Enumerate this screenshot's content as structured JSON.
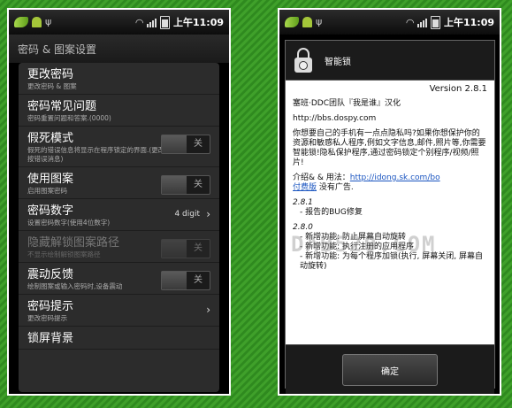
{
  "status_bar": {
    "time": "上午11:09"
  },
  "left_screen": {
    "title": "密码 & 图案设置",
    "items": [
      {
        "title": "更改密码",
        "subtitle": "更改密码 & 图案"
      },
      {
        "title": "密码常见问题",
        "subtitle": "密码重置问题和答案.(0000)"
      },
      {
        "title": "假死模式",
        "subtitle": "假死的错误信息将显示在程序锁定的界面.(更改授权查看时长按错误消息)",
        "toggle": "关"
      },
      {
        "title": "使用图案",
        "subtitle": "启用图案密码",
        "toggle": "关"
      },
      {
        "title": "密码数字",
        "subtitle": "设置密码数字(使用4位数字)",
        "value": "4 digit"
      },
      {
        "title": "隐藏解锁图案路径",
        "subtitle": "不显示绘制解锁图案路径",
        "toggle": "关"
      },
      {
        "title": "震动反馈",
        "subtitle": "绘制图案或输入密码时,设备震动",
        "toggle": "关"
      },
      {
        "title": "密码提示",
        "subtitle": "更改密码提示"
      },
      {
        "title": "锁屏背景",
        "subtitle": ""
      }
    ]
  },
  "right_screen": {
    "dialog_title": "智能锁",
    "version": "Version 2.8.1",
    "credit": "塞班·DDC团队『我是谁』汉化",
    "url": "http://bbs.dospy.com",
    "intro": "你想要自己的手机有一点点隐私吗?如果你想保护你的资源和敏感私人程序,例如文字信息,邮件,照片等,你需要智能锁!隐私保护程序,通过密码锁定个别程序/视频/照片!",
    "intro_link_prefix": "介绍& & 用法：",
    "intro_link": "http://idong.sk.com/bo",
    "paid_link": "付费版",
    "paid_text": "没有广告.",
    "v1_header": "2.8.1",
    "v1_items": [
      "- 报告的BUG修复"
    ],
    "v2_header": "2.8.0",
    "v2_items": [
      "- 新增功能: 防止屏幕自动旋转",
      "- 新增功能: 执行注册的应用程序",
      "- 新增功能: 为每个程序加锁(执行, 屏幕关闭, 屏幕自动旋转)"
    ],
    "ok_button": "确定",
    "watermark": "DAB520.COM"
  }
}
